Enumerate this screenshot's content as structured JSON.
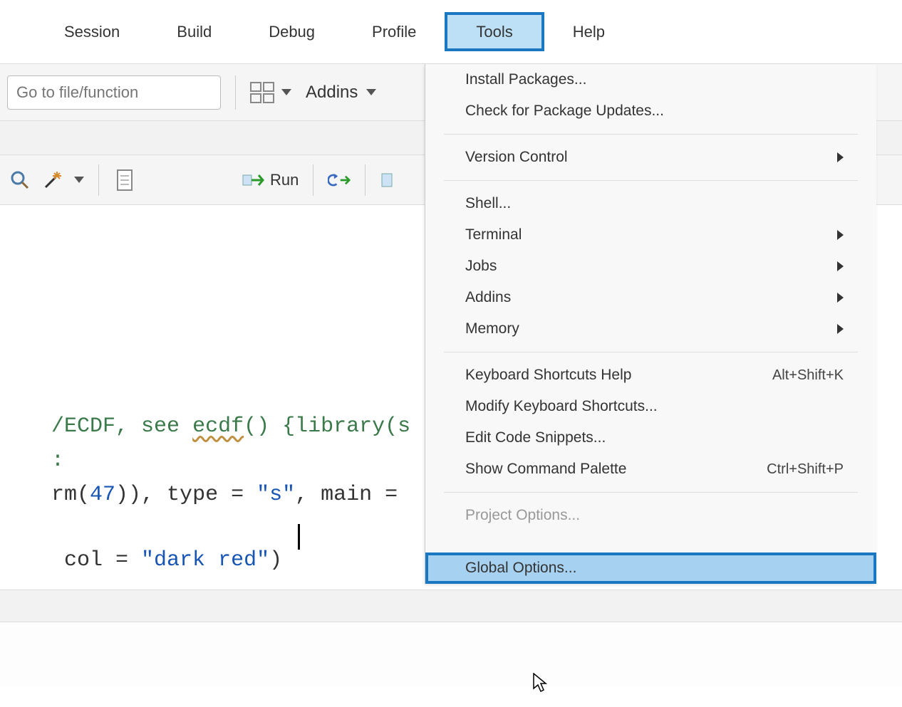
{
  "menubar": {
    "items": [
      {
        "label": "Session"
      },
      {
        "label": "Build"
      },
      {
        "label": "Debug"
      },
      {
        "label": "Profile"
      },
      {
        "label": "Tools"
      },
      {
        "label": "Help"
      }
    ],
    "active_index": 4
  },
  "toolbar": {
    "goto_placeholder": "Go to file/function",
    "addins_label": "Addins"
  },
  "editor_toolbar": {
    "run_label": "Run"
  },
  "code": {
    "line1_a": "/ECDF, see ",
    "line1_b": "ecdf",
    "line1_c": "() {library(s",
    "line2": ":",
    "line3_a": "rm(",
    "line3_b": "47",
    "line3_c": ")), type = ",
    "line3_d": "\"s\"",
    "line3_e": ", main = ",
    "line4_a": " col = ",
    "line4_b": "\"dark red\"",
    "line4_c": ")"
  },
  "tools_menu": {
    "install_packages": "Install Packages...",
    "check_updates": "Check for Package Updates...",
    "version_control": "Version Control",
    "shell": "Shell...",
    "terminal": "Terminal",
    "jobs": "Jobs",
    "addins": "Addins",
    "memory": "Memory",
    "keyboard_help": "Keyboard Shortcuts Help",
    "keyboard_help_shortcut": "Alt+Shift+K",
    "modify_shortcuts": "Modify Keyboard Shortcuts...",
    "edit_snippets": "Edit Code Snippets...",
    "command_palette": "Show Command Palette",
    "command_palette_shortcut": "Ctrl+Shift+P",
    "project_options": "Project Options...",
    "global_options": "Global Options..."
  }
}
